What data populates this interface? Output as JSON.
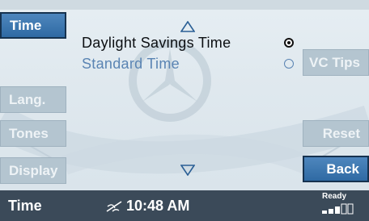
{
  "left_menu": {
    "time": "Time",
    "lang": "Lang.",
    "tones": "Tones",
    "display": "Display"
  },
  "options": {
    "daylight": "Daylight Savings Time",
    "standard": "Standard Time",
    "selected": "daylight"
  },
  "right_menu": {
    "vc_tips": "VC Tips",
    "reset": "Reset",
    "back": "Back"
  },
  "status_bar": {
    "title": "Time",
    "clock": "10:48 AM",
    "ready": "Ready"
  },
  "colors": {
    "accent": "#3a77b3",
    "status_bg": "#3b4a59"
  }
}
